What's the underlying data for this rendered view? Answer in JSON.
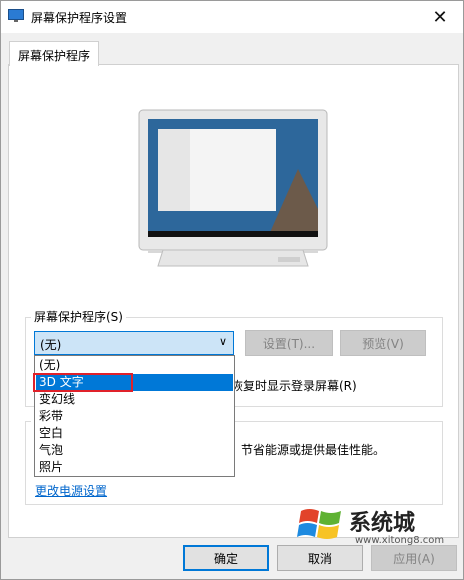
{
  "window": {
    "title": "屏幕保护程序设置",
    "close_glyph": "✕"
  },
  "tab": {
    "label": "屏幕保护程序"
  },
  "screensaver_group": {
    "label": "屏幕保护程序(S)",
    "selected_value": "(无)",
    "settings_button": "设置(T)...",
    "preview_button": "预览(V)",
    "resume_text": "恢复时显示登录屏幕(R)",
    "options": [
      "(无)",
      "3D 文字",
      "变幻线",
      "彩带",
      "空白",
      "气泡",
      "照片"
    ],
    "highlighted_index": 1
  },
  "power_group": {
    "text": "节省能源或提供最佳性能。",
    "link": "更改电源设置"
  },
  "buttons": {
    "ok": "确定",
    "cancel": "取消",
    "apply": "应用(A)"
  },
  "watermark": {
    "title": "系统城",
    "url": "www.xitong8.com"
  },
  "colors": {
    "accent": "#0078d7",
    "highlight_box": "#e0212a",
    "link": "#0066cc"
  }
}
